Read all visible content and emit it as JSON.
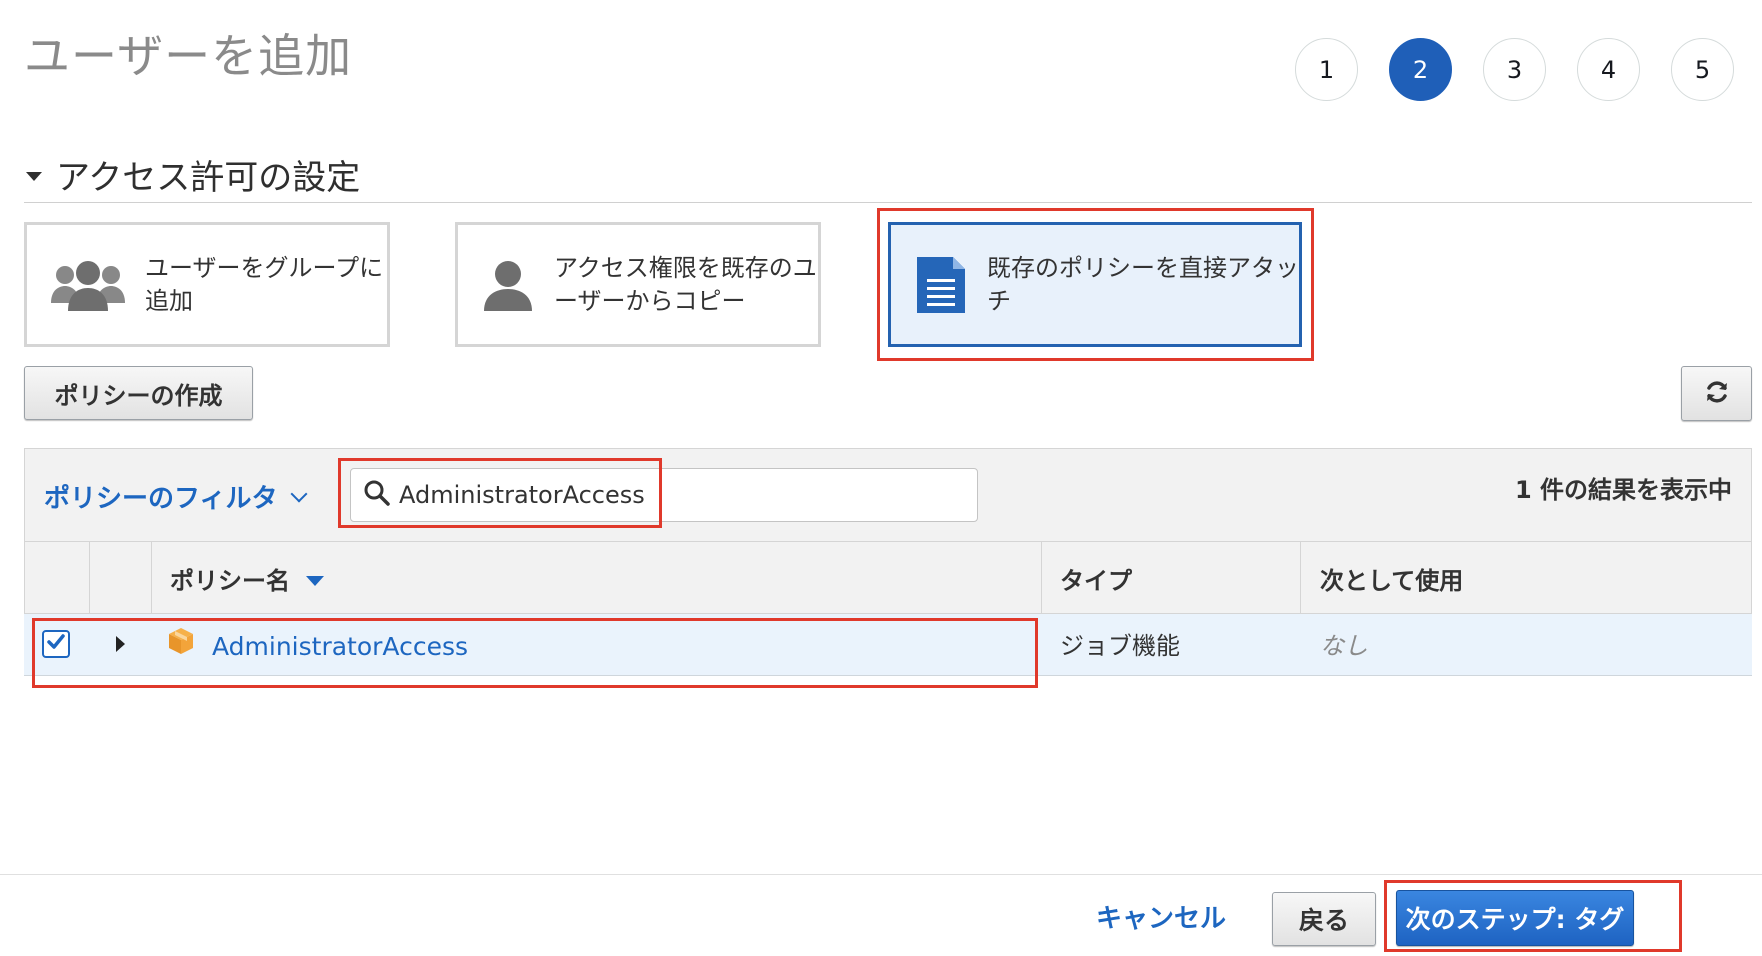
{
  "page": {
    "title": "ユーザーを追加"
  },
  "steps": [
    "1",
    "2",
    "3",
    "4",
    "5"
  ],
  "active_step": "2",
  "section": {
    "title": "アクセス許可の設定",
    "collapse_icon": "caret-down-icon"
  },
  "options": [
    {
      "label": "ユーザーをグループに追加",
      "icon": "group-icon",
      "selected": false
    },
    {
      "label": "アクセス権限を既存のユーザーからコピー",
      "icon": "user-icon",
      "selected": false
    },
    {
      "label": "既存のポリシーを直接アタッチ",
      "icon": "document-icon",
      "selected": true
    }
  ],
  "toolbar": {
    "create_policy": "ポリシーの作成",
    "refresh_icon": "refresh-icon"
  },
  "filter": {
    "label": "ポリシーのフィルタ",
    "search_value": "AdministratorAccess",
    "result_count": "1 件の結果を表示中"
  },
  "table": {
    "columns": {
      "name": "ポリシー名",
      "type": "タイプ",
      "used_as": "次として使用"
    },
    "rows": [
      {
        "checked": true,
        "name": "AdministratorAccess",
        "type": "ジョブ機能",
        "used_as": "なし"
      }
    ]
  },
  "footer": {
    "cancel": "キャンセル",
    "back": "戻る",
    "next": "次のステップ: タグ"
  },
  "colors": {
    "accent": "#1f5fb8",
    "link": "#1d66c0",
    "highlight": "#e0392b",
    "selected_bg": "#e8f1fb"
  }
}
